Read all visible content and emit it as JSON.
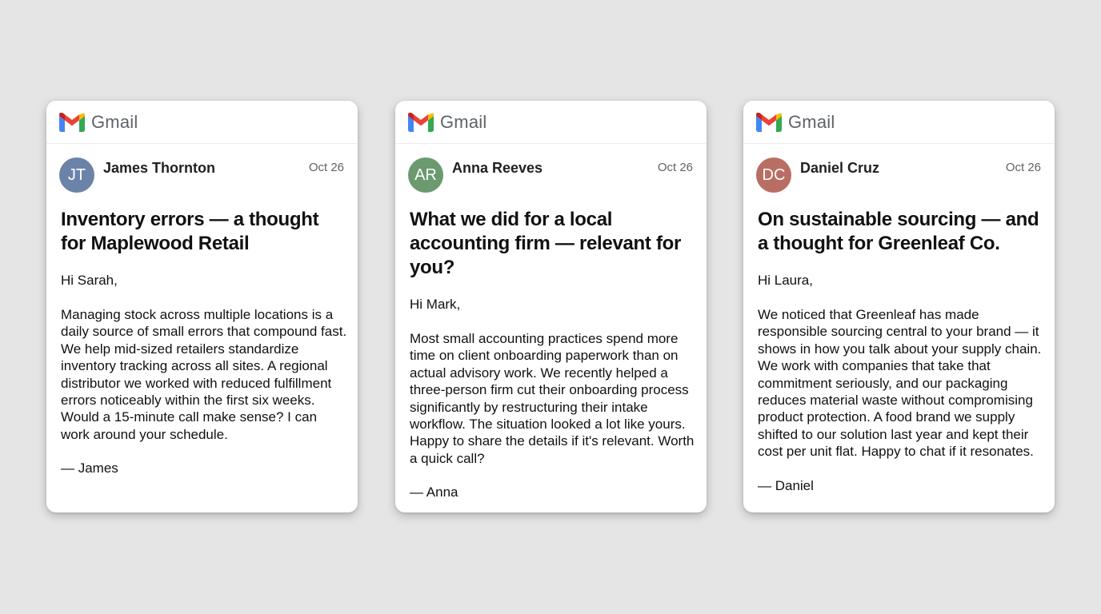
{
  "brand": {
    "name": "Gmail"
  },
  "colors": {
    "background": "#e5e5e5",
    "gmail_red": "#ea4335",
    "gmail_blue": "#4285f4",
    "gmail_green": "#34a853",
    "gmail_yellow": "#fbbc04",
    "gmail_dark_red": "#c5221f"
  },
  "cards": [
    {
      "sender": {
        "initials": "JT",
        "name": "James Thornton",
        "avatar_color": "#6b83a9"
      },
      "date": "Oct 26",
      "subject": "Inventory errors — a thought for Maplewood Retail",
      "greeting": "Hi Sarah,",
      "body": "Managing stock across multiple locations is a daily source of small errors that compound fast. We help mid-sized retailers standardize inventory tracking across all sites. A regional distributor we worked with reduced fulfillment errors noticeably within the first six weeks. Would a 15-minute call make sense? I can work around your schedule.",
      "signoff": "— James"
    },
    {
      "sender": {
        "initials": "AR",
        "name": "Anna Reeves",
        "avatar_color": "#6a9a6e"
      },
      "date": "Oct 26",
      "subject": "What we did for a local accounting firm — relevant for you?",
      "greeting": "Hi Mark,",
      "body": "Most small accounting practices spend more time on client onboarding paperwork than on actual advisory work. We recently helped a three-person firm cut their onboarding process significantly by restructuring their intake workflow. The situation looked a lot like yours. Happy to share the details if it's relevant. Worth a quick call?",
      "signoff": "— Anna"
    },
    {
      "sender": {
        "initials": "DC",
        "name": "Daniel Cruz",
        "avatar_color": "#b96e63"
      },
      "date": "Oct 26",
      "subject": "On sustainable sourcing — and a thought for Greenleaf Co.",
      "greeting": "Hi Laura,",
      "body": "We noticed that Greenleaf has made responsible sourcing central to your brand — it shows in how you talk about your supply chain. We work with companies that take that commitment seriously, and our packaging reduces material waste without compromising product protection. A food brand we supply shifted to our solution last year and kept their cost per unit flat. Happy to chat if it resonates.",
      "signoff": "— Daniel"
    }
  ]
}
